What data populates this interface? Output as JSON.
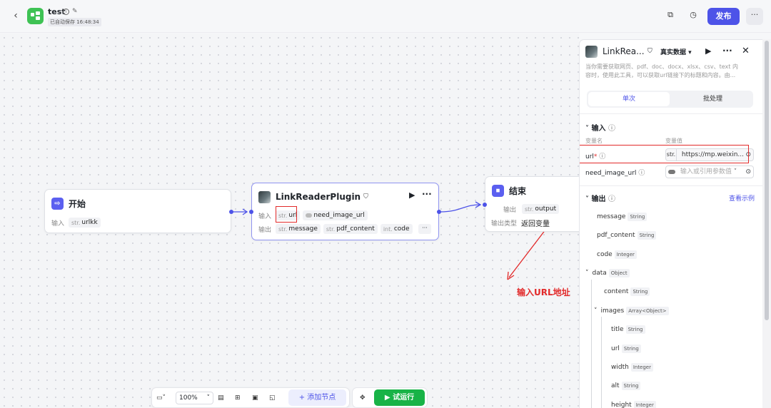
{
  "header": {
    "title": "test",
    "autosave": "已自动保存 16:48:34",
    "publish_label": "发布",
    "more_label": "···"
  },
  "nodes": {
    "start": {
      "title": "开始",
      "input_label": "输入",
      "param_type": "str.",
      "param_name": "urlkk"
    },
    "plugin": {
      "title": "LinkReaderPlugin",
      "input_label": "输入",
      "inputs": [
        {
          "type": "str.",
          "name": "url"
        },
        {
          "name": "need_image_url"
        }
      ],
      "output_label": "输出",
      "outputs": [
        {
          "type": "str.",
          "name": "message"
        },
        {
          "type": "str.",
          "name": "pdf_content"
        },
        {
          "type": "int.",
          "name": "code"
        }
      ],
      "more_label": "···"
    },
    "end": {
      "title": "结束",
      "output_label": "输出",
      "output_type": "str.",
      "output_name": "output",
      "return_label": "输出类型",
      "return_value": "返回变量"
    }
  },
  "annotation": "输入URL地址",
  "toolbar": {
    "zoom": "100%",
    "add_node": "添加节点",
    "run": "试运行"
  },
  "panel": {
    "title": "LinkRea...",
    "data_mode": "真实数据",
    "description_line1": "当你需要获取网页、pdf、doc、docx、xlsx、csv、text 内",
    "description_line2": "容时，使用此工具，可以获取url链接下的标题和内容。由...",
    "tabs": {
      "single": "单次",
      "batch": "批处理"
    },
    "input_section": "输入",
    "col_name": "变量名",
    "col_value": "变量值",
    "inputs": [
      {
        "name": "url",
        "required": "*",
        "type": "str.",
        "value": "https://mp.weixin..."
      },
      {
        "name": "need_image_url",
        "placeholder": "输入或引用参数值"
      }
    ],
    "output_section": "输出",
    "view_example": "查看示例",
    "outputs": [
      {
        "name": "message",
        "type": "String"
      },
      {
        "name": "pdf_content",
        "type": "String"
      },
      {
        "name": "code",
        "type": "Integer"
      },
      {
        "name": "data",
        "type": "Object"
      },
      {
        "name": "content",
        "type": "String"
      },
      {
        "name": "images",
        "type": "Array<Object>"
      },
      {
        "name": "title",
        "type": "String"
      },
      {
        "name": "url",
        "type": "String"
      },
      {
        "name": "width",
        "type": "Integer"
      },
      {
        "name": "alt",
        "type": "String"
      },
      {
        "name": "height",
        "type": "Integer"
      }
    ]
  },
  "colors": {
    "accent": "#4d53e8",
    "run_green": "#18b347",
    "annotation_red": "#e22a2a",
    "app_green": "#3ec254"
  },
  "icons": [
    "back-icon",
    "app-icon",
    "info-icon",
    "edit-icon",
    "copy-icon",
    "history-icon",
    "more-icon",
    "play-icon",
    "close-icon",
    "chevron-down-icon",
    "minimap-icon",
    "comment-icon",
    "layout-icon",
    "image-icon",
    "fit-icon",
    "plus-icon",
    "pointer-icon"
  ]
}
